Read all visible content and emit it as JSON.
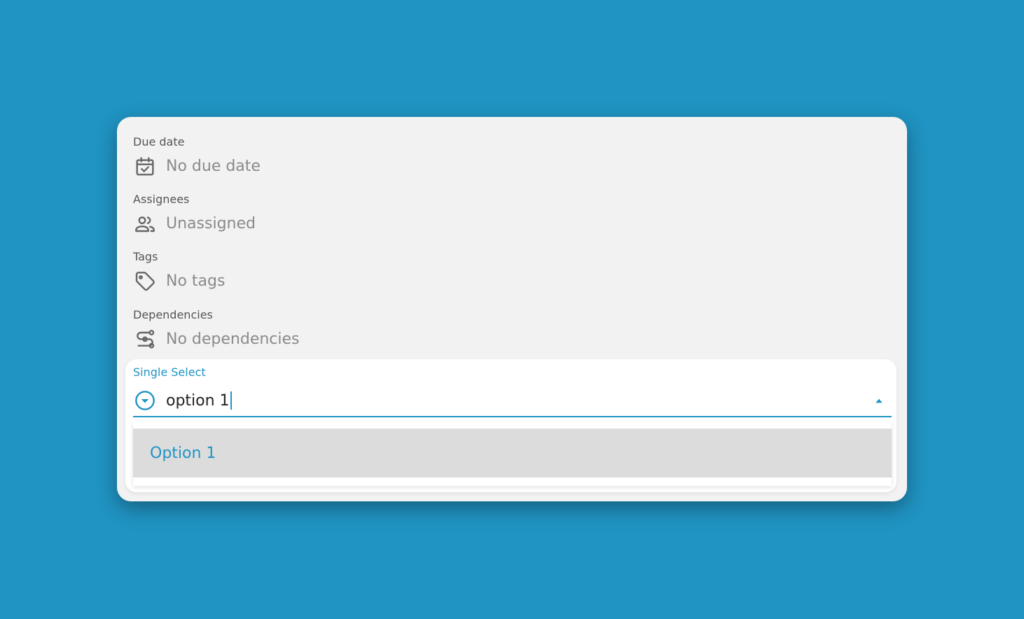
{
  "fields": {
    "due_date": {
      "label": "Due date",
      "value": "No due date",
      "icon": "calendar-check-icon"
    },
    "assignees": {
      "label": "Assignees",
      "value": "Unassigned",
      "icon": "people-icon"
    },
    "tags": {
      "label": "Tags",
      "value": "No tags",
      "icon": "tag-icon"
    },
    "dependencies": {
      "label": "Dependencies",
      "value": "No dependencies",
      "icon": "dependencies-icon"
    }
  },
  "single_select": {
    "label": "Single Select",
    "input_value": "option 1",
    "icon": "circle-chevron-down-icon",
    "options": [
      {
        "label": "Option 1"
      }
    ]
  },
  "colors": {
    "background": "#2094c3",
    "accent": "#2094c3",
    "card": "#f2f2f2",
    "highlight": "#dcdcdc"
  }
}
